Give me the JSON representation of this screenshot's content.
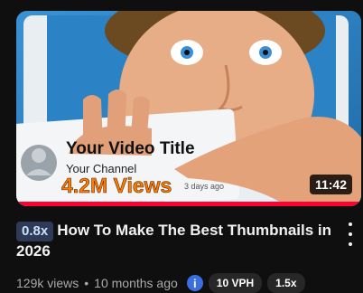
{
  "video": {
    "duration": "11:42",
    "watch_progress": 1.0,
    "speed_badge": "0.8x",
    "title": "How To Make The Best Thumbnails in 2026",
    "views": "129k views",
    "separator": "•",
    "age": "10 months ago",
    "info_icon_label": "i",
    "vph_badge": "10 VPH",
    "multiplier_badge": "1.5x"
  },
  "thumbnail_art": {
    "card_title": "Your Video Title",
    "card_channel": "Your Channel",
    "card_views": "4.2M Views",
    "card_age": "3 days ago",
    "colors": {
      "background": "#2a7fc0",
      "views_text": "#ff7a00",
      "accent": "#ff0033"
    }
  }
}
